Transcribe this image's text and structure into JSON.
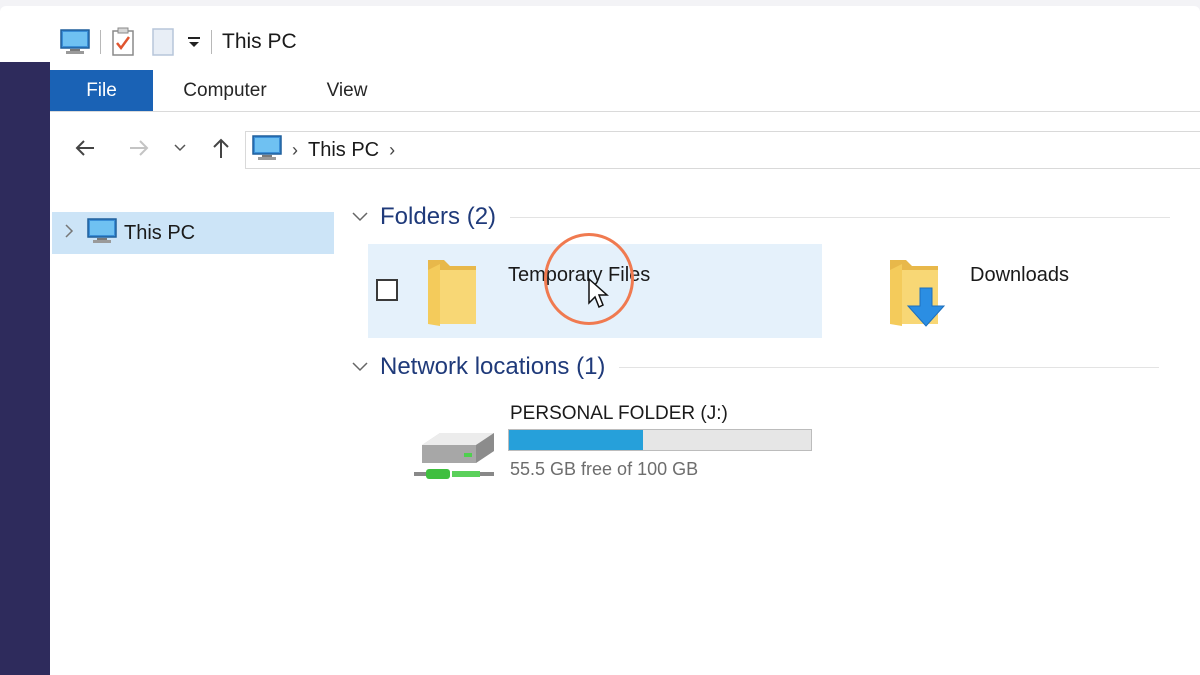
{
  "window": {
    "title": "This PC",
    "colors": {
      "accent": "#1a62b5",
      "selection": "#cce4f7",
      "hover": "#e5f1fb",
      "group_title": "#1f3a7a",
      "left_strip": "#2e2b5c",
      "progress": "#26a0da",
      "highlight_ring": "#f07a50"
    }
  },
  "quick_access": {
    "icons": [
      "computer-icon",
      "properties-checkmark-icon",
      "new-folder-icon",
      "customize-dropdown-icon"
    ]
  },
  "ribbon": {
    "tabs": [
      {
        "label": "File",
        "active": true
      },
      {
        "label": "Computer",
        "active": false
      },
      {
        "label": "View",
        "active": false
      }
    ]
  },
  "navigation": {
    "buttons": [
      "back-arrow-icon",
      "forward-arrow-icon",
      "recent-locations-chevron-icon",
      "up-arrow-icon"
    ],
    "address": {
      "crumbs": [
        "This PC"
      ]
    }
  },
  "tree": {
    "items": [
      {
        "label": "This PC",
        "selected": true
      }
    ]
  },
  "content": {
    "groups": [
      {
        "title": "Folders (2)",
        "items": [
          {
            "name": "Temporary Files",
            "icon": "folder-icon",
            "selected": true
          },
          {
            "name": "Downloads",
            "icon": "downloads-folder-icon",
            "selected": false
          }
        ]
      },
      {
        "title": "Network locations (1)",
        "items": [
          {
            "name": "PERSONAL FOLDER (J:)",
            "icon": "network-drive-icon",
            "free_text": "55.5 GB free of 100 GB",
            "used_fraction": 0.445
          }
        ]
      }
    ]
  }
}
